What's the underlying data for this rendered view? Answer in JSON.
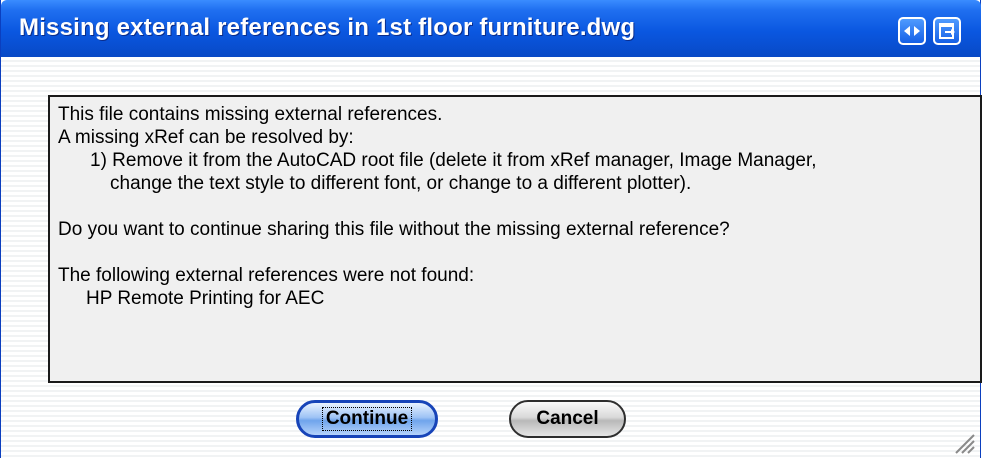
{
  "window": {
    "title": "Missing external references in 1st floor furniture.dwg",
    "titlebar_color": "#0a57e0"
  },
  "message": {
    "line1": "This file contains missing external references.",
    "line2": "A missing xRef can be resolved by:",
    "line3": "1) Remove it from the AutoCAD root file (delete it from xRef manager, Image Manager,",
    "line4": "change the text style to different font, or change to a different plotter).",
    "question": "Do you want to continue sharing this file without the missing external reference?",
    "not_found_heading": "The following external references were not found:",
    "missing_refs": [
      "HP Remote Printing for AEC"
    ]
  },
  "buttons": {
    "continue_label": "Continue",
    "cancel_label": "Cancel"
  },
  "icons": {
    "titlebar_left": "expand-horizontal-icon",
    "titlebar_right": "restore-window-icon",
    "resize": "resize-grip-icon"
  }
}
